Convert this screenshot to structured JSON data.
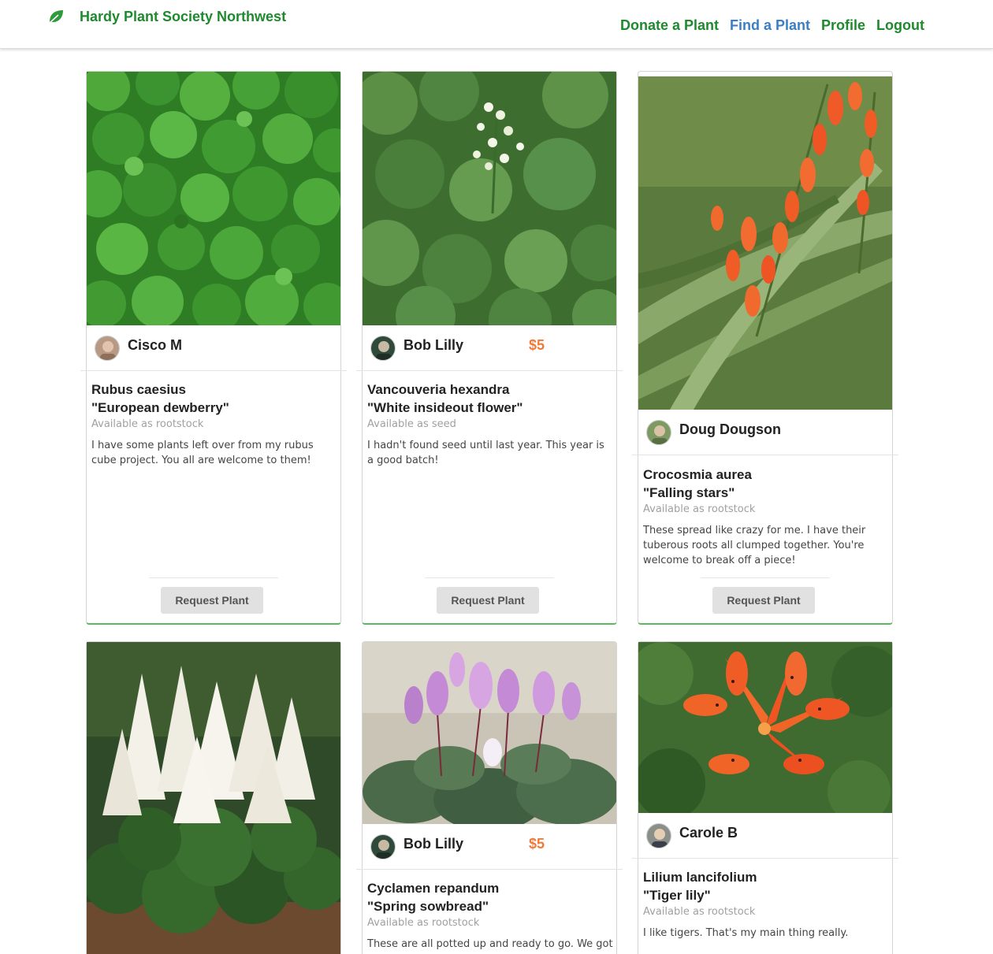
{
  "brand": {
    "name": "Hardy Plant Society Northwest",
    "icon": "leaf-icon",
    "color": "#1e8a2e"
  },
  "nav": {
    "donate": "Donate a Plant",
    "find": "Find a Plant",
    "profile": "Profile",
    "logout": "Logout",
    "active": "find",
    "active_color": "#3a7fc4"
  },
  "accent": {
    "price_color": "#f07a3a",
    "card_border_bottom": "#5cb85c"
  },
  "request_label": "Request Plant",
  "listings": [
    {
      "owner": "Cisco M",
      "price": "",
      "latin_name": "Rubus caesius",
      "common_name": "\"European dewberry\"",
      "availability": "Available as rootstock",
      "description": "I have some plants left over from my rubus cube project. You all are welcome to them!"
    },
    {
      "owner": "Bob Lilly",
      "price": "$5",
      "latin_name": "Vancouveria hexandra",
      "common_name": "\"White insideout flower\"",
      "availability": "Available as seed",
      "description": "I hadn't found seed until last year. This year is a good batch!"
    },
    {
      "owner": "Doug Dougson",
      "price": "",
      "latin_name": "Crocosmia aurea",
      "common_name": "\"Falling stars\"",
      "availability": "Available as rootstock",
      "description": "These spread like crazy for me. I have their tuberous roots all clumped together. You're welcome to break off a piece!"
    },
    {
      "owner": "",
      "price": "",
      "latin_name": "",
      "common_name": "",
      "availability": "",
      "description": ""
    },
    {
      "owner": "Bob Lilly",
      "price": "$5",
      "latin_name": "Cyclamen repandum",
      "common_name": "\"Spring sowbread\"",
      "availability": "Available as rootstock",
      "description": "These are all potted up and ready to go. We got"
    },
    {
      "owner": "Carole B",
      "price": "",
      "latin_name": "Lilium lancifolium",
      "common_name": "\"Tiger lily\"",
      "availability": "Available as rootstock",
      "description": "I like tigers. That's my main thing really."
    }
  ]
}
